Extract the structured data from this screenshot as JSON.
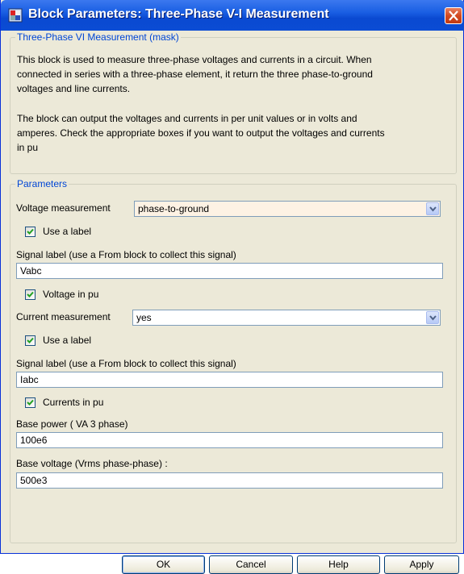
{
  "window": {
    "title": "Block Parameters: Three-Phase V-I Measurement",
    "icon": "simulink-block-icon",
    "close_icon": "close-icon"
  },
  "mask": {
    "legend": "Three-Phase VI Measurement (mask)",
    "paragraph1_lines": [
      "This block is used to measure three-phase voltages and currents in a circuit. When",
      "connected in series with a  three-phase element, it return the three phase-to-ground",
      "voltages and line currents."
    ],
    "paragraph2_lines": [
      "The block can output the voltages and currents in per unit values or in volts and",
      "amperes. Check the appropriate boxes if you want to output the voltages and currents",
      "in pu"
    ]
  },
  "parameters": {
    "legend": "Parameters",
    "voltage_measurement": {
      "label": "Voltage measurement",
      "value": "phase-to-ground"
    },
    "use_label_1": {
      "label": "Use a label",
      "checked": true
    },
    "signal_label_1": {
      "label": "Signal label  (use a From block to collect this signal)",
      "value": "Vabc"
    },
    "voltage_pu": {
      "label": "Voltage  in pu",
      "checked": true
    },
    "current_measurement": {
      "label": "Current measurement",
      "value": "yes"
    },
    "use_label_2": {
      "label": "Use a label",
      "checked": true
    },
    "signal_label_2": {
      "label": "Signal label  (use a From block to collect this signal)",
      "value": "Iabc"
    },
    "currents_pu": {
      "label": "Currents in pu",
      "checked": true
    },
    "base_power": {
      "label": "Base power ( VA 3 phase)",
      "value": "100e6"
    },
    "base_voltage": {
      "label": "Base voltage (Vrms phase-phase) :",
      "value": "500e3"
    }
  },
  "buttons": {
    "ok": "OK",
    "cancel": "Cancel",
    "help": "Help",
    "apply": "Apply"
  },
  "colors": {
    "titlebar": "#0a49d1",
    "dialog_bg": "#ece9d8",
    "legend_text": "#0046d5",
    "voltage_select_bg": "#fdf2e4",
    "current_select_bg": "#ffffff",
    "close_button": "#d24a22"
  }
}
